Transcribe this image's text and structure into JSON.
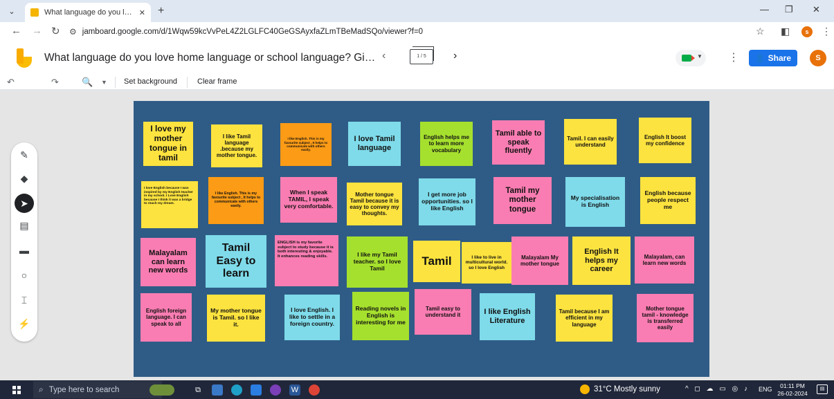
{
  "browser": {
    "tab_title": "What language do you love home language or school language? Give a reason",
    "close_glyph": "✕",
    "newtab_glyph": "+",
    "url": "jamboard.google.com/d/1Wqw59kcVvPeL4Z2LGLFC40GeGSAyxfaZLmTBeMadSQo/viewer?f=0",
    "profile_initial": "s"
  },
  "header": {
    "title": "What language do you love home language or school language? Give a rea...",
    "frame_indicator": "1 / 5",
    "share_label": "Share",
    "avatar_initial": "S"
  },
  "toolbar": {
    "set_background": "Set background",
    "clear_frame": "Clear frame"
  },
  "notes": [
    {
      "text": "I love my mother tongue in tamil",
      "color": "yellow"
    },
    {
      "text": "I like Tamil language .because my mother tongue.",
      "color": "yellow"
    },
    {
      "text": "I like English. This is my favourite subject , It helps to communicate with others easily.",
      "color": "orange"
    },
    {
      "text": "I love Tamil language",
      "color": "cyan"
    },
    {
      "text": "English helps me to learn more vocabulary",
      "color": "green"
    },
    {
      "text": "Tamil able to speak fluently",
      "color": "pink"
    },
    {
      "text": "Tamil. I can easily understand",
      "color": "yellow"
    },
    {
      "text": "English It boost my confidence",
      "color": "yellow"
    },
    {
      "text": "I love English because I was inspired by my English teacher in my school. I Love English because I think it was a bridge to reach my dream.",
      "color": "yellow"
    },
    {
      "text": "I like English. This is my favourite subject , It helps to communicate with others easily.",
      "color": "orange"
    },
    {
      "text": "When I speak TAMIL, I speak very comfortable.",
      "color": "pink"
    },
    {
      "text": "Mother tongue Tamil because it is easy to convey my thoughts.",
      "color": "yellow"
    },
    {
      "text": "I get more job opportunities. so I like English",
      "color": "cyan"
    },
    {
      "text": "Tamil my mother tongue",
      "color": "pink"
    },
    {
      "text": "My specialisation is English",
      "color": "cyan"
    },
    {
      "text": "English because people respect me",
      "color": "yellow"
    },
    {
      "text": "Malayalam can learn new words",
      "color": "pink"
    },
    {
      "text": "Tamil Easy to learn",
      "color": "cyan"
    },
    {
      "text": "ENGLISH is my favorite subject to study because it is both interesting & enjoyable. It enhances reading skills.",
      "color": "pink"
    },
    {
      "text": "I like my Tamil teacher. so I love Tamil",
      "color": "green"
    },
    {
      "text": "Tamil",
      "color": "yellow"
    },
    {
      "text": "I like to live in multicultural world. so I love English",
      "color": "yellow"
    },
    {
      "text": "Malayalam My mother tongue",
      "color": "pink"
    },
    {
      "text": "English It helps my career",
      "color": "yellow"
    },
    {
      "text": "Malayalam, can learn new words",
      "color": "pink"
    },
    {
      "text": "English foreign language. I can speak to all",
      "color": "pink"
    },
    {
      "text": "My mother tongue is Tamil. so I like it.",
      "color": "yellow"
    },
    {
      "text": "I love English. I like to settle in a foreign country.",
      "color": "cyan"
    },
    {
      "text": "Reading novels in English is interesting for me",
      "color": "green"
    },
    {
      "text": "Tamil easy to understand it",
      "color": "pink"
    },
    {
      "text": "I like English Literature",
      "color": "cyan"
    },
    {
      "text": "Tamil because I am efficient in my language",
      "color": "yellow"
    },
    {
      "text": "Mother tongue tamil - knowledge is transferred easily",
      "color": "pink"
    }
  ],
  "taskbar": {
    "search_placeholder": "Type here to search",
    "weather": "31°C  Mostly sunny",
    "lang": "ENG",
    "time": "01:11 PM",
    "date": "26-02-2024"
  }
}
